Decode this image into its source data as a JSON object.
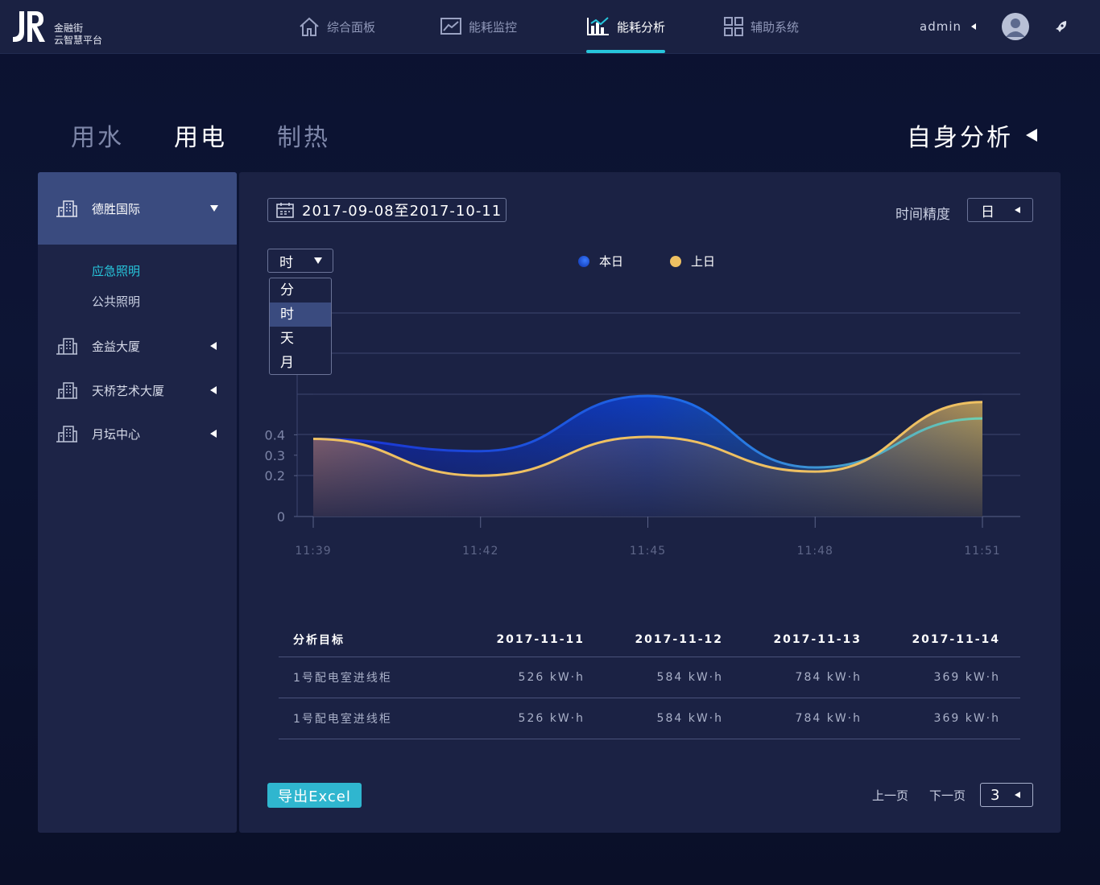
{
  "brand": {
    "line1": "金融街",
    "line2": "云智慧平台"
  },
  "nav": [
    {
      "label": "综合面板",
      "icon": "home-icon"
    },
    {
      "label": "能耗监控",
      "icon": "line-chart-icon"
    },
    {
      "label": "能耗分析",
      "icon": "bar-chart-icon",
      "active": true
    },
    {
      "label": "辅助系统",
      "icon": "grid-icon"
    }
  ],
  "user": {
    "name": "admin"
  },
  "categories": [
    "用水",
    "用电",
    "制热"
  ],
  "active_category": "用电",
  "analysis_mode": "自身分析",
  "sidebar": {
    "buildings": [
      {
        "label": "德胜国际",
        "expanded": true,
        "children": [
          "应急照明",
          "公共照明"
        ],
        "active_child": "应急照明"
      },
      {
        "label": "金益大厦"
      },
      {
        "label": "天桥艺术大厦"
      },
      {
        "label": "月坛中心"
      }
    ]
  },
  "filters": {
    "date_range": "2017-09-08至2017-10-11",
    "precision_label": "时间精度",
    "precision_value": "日",
    "granularity_value": "时",
    "granularity_options": [
      "分",
      "时",
      "天",
      "月"
    ],
    "granularity_selected": "时"
  },
  "legend": [
    {
      "name": "本日",
      "color": "#1e5fe0"
    },
    {
      "name": "上日",
      "color": "#eec062"
    }
  ],
  "chart_data": {
    "type": "area",
    "x": [
      "11:39",
      "11:42",
      "11:45",
      "11:48",
      "11:51"
    ],
    "y_ticks": [
      "0",
      "0.2",
      "0.3",
      "0.4"
    ],
    "series": [
      {
        "name": "本日",
        "values": [
          0.38,
          0.32,
          0.59,
          0.24,
          0.48
        ]
      },
      {
        "name": "上日",
        "values": [
          0.38,
          0.2,
          0.39,
          0.22,
          0.56
        ]
      }
    ]
  },
  "table": {
    "headers": [
      "分析目标",
      "2017-11-11",
      "2017-11-12",
      "2017-11-13",
      "2017-11-14"
    ],
    "rows": [
      [
        "1号配电室进线柜",
        "526 kW·h",
        "584 kW·h",
        "784 kW·h",
        "369 kW·h"
      ],
      [
        "1号配电室进线柜",
        "526 kW·h",
        "584 kW·h",
        "784 kW·h",
        "369 kW·h"
      ]
    ]
  },
  "footer": {
    "export_label": "导出Excel",
    "prev_label": "上一页",
    "next_label": "下一页",
    "page": "3"
  },
  "colors": {
    "accent": "#27c6dc",
    "panel": "#1b2244",
    "sidebar_active": "#3a4b7f",
    "series_today": "#1e5fe0",
    "series_yesterday": "#eec062"
  }
}
